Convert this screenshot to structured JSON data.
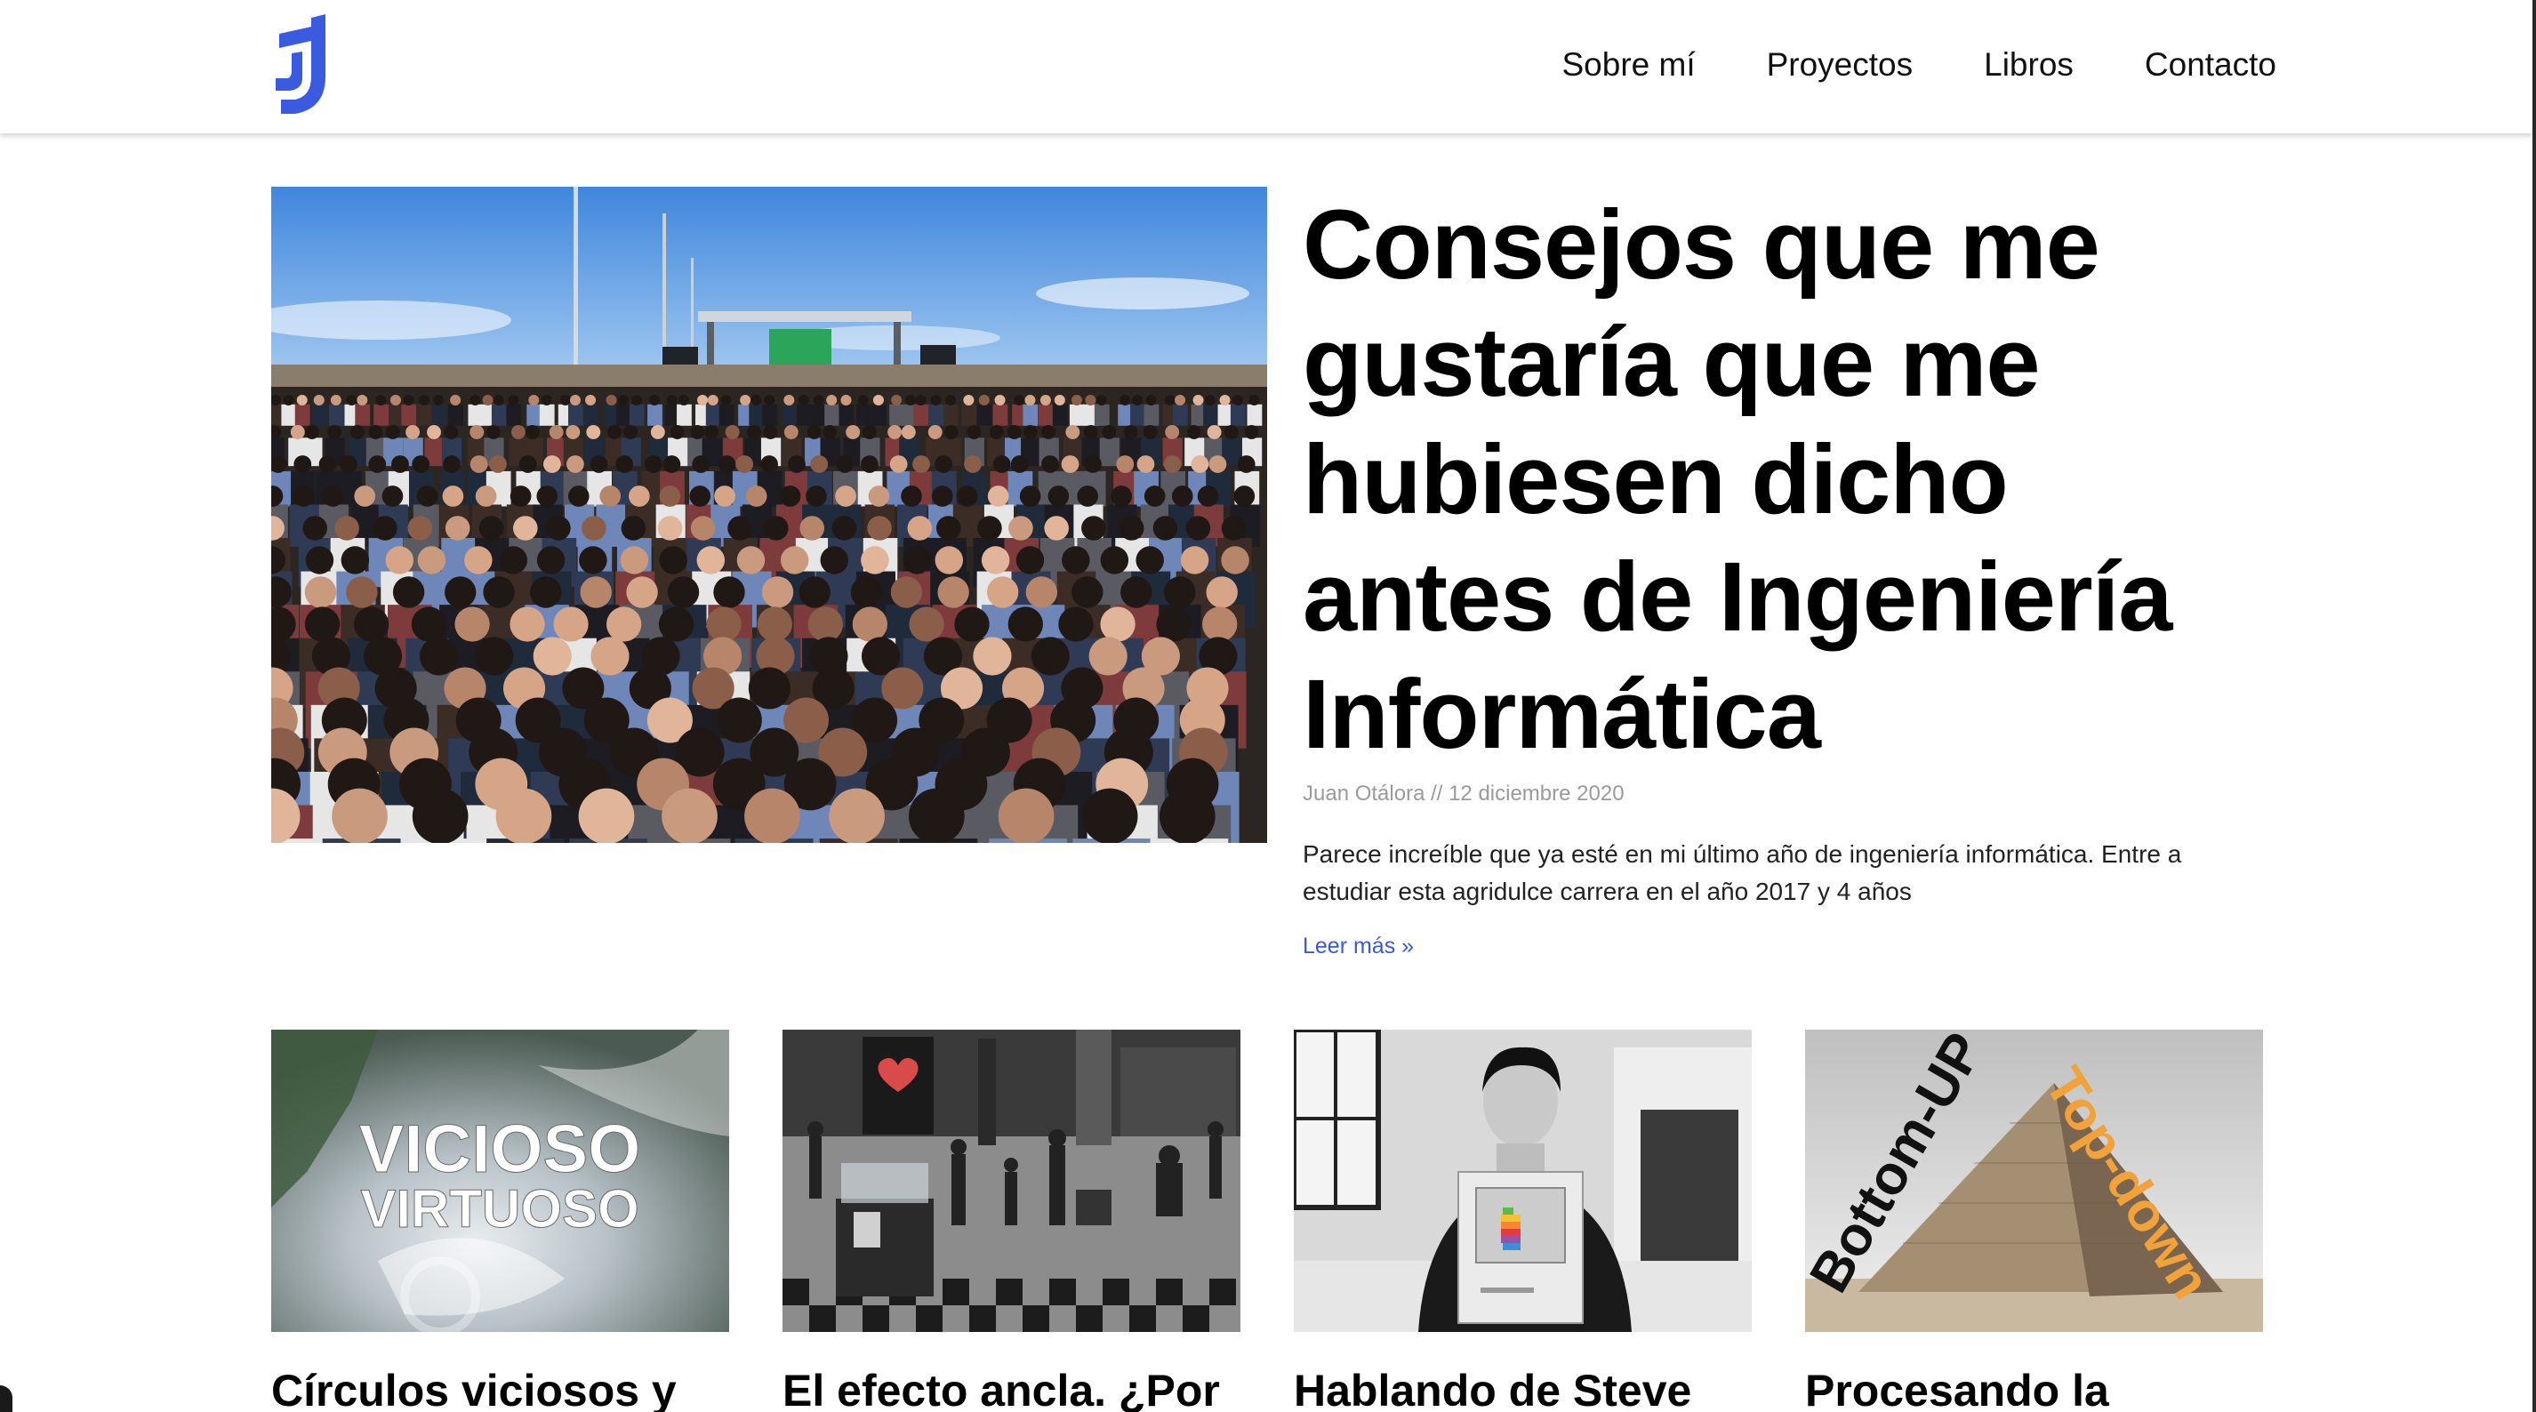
{
  "site": {
    "logo_letter": "J",
    "brand_color": "#3a5be0"
  },
  "nav": {
    "items": [
      {
        "label": "Sobre mí"
      },
      {
        "label": "Proyectos"
      },
      {
        "label": "Libros"
      },
      {
        "label": "Contacto"
      }
    ]
  },
  "featured": {
    "title": "Consejos que me gustaría que me hubiesen dicho antes de Ingeniería Informática",
    "meta": "Juan Otálora // 12 diciembre 2020",
    "excerpt": "Parece increíble que ya esté en mi último año de ingeniería informática. Entre a estudiar esta agridulce carrera en el año 2017 y 4 años",
    "read_more": "Leer más »",
    "image_subject": "festival-crowd-photo"
  },
  "posts": [
    {
      "title": "Círculos viciosos y",
      "image_text_line1": "VICIOSO",
      "image_text_line2": "VIRTUOSO",
      "image_subject": "hurricane-satellite"
    },
    {
      "title": "El efecto ancla. ¿Por",
      "image_subject": "street-scene-bw"
    },
    {
      "title": "Hablando de Steve",
      "image_text_line1": "",
      "image_text_line2": "",
      "image_subject": "steve-jobs-macintosh"
    },
    {
      "title": "Procesando la",
      "image_text_line1": "Bottom-UP",
      "image_text_line2": "Top-down",
      "image_subject": "pyramid"
    }
  ],
  "colors": {
    "link": "#3a59d6",
    "meta": "#9a9a9a",
    "sky": "#4d8fe0",
    "pyramid_orange": "#f2a23a"
  }
}
